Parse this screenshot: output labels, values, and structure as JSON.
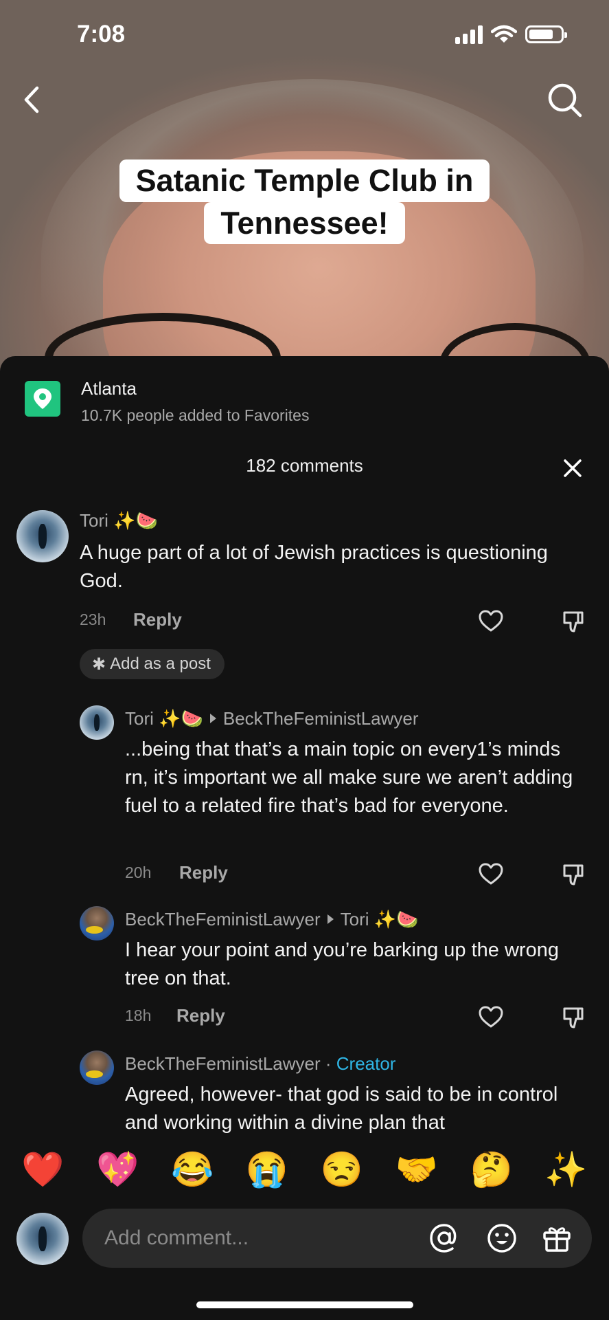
{
  "status": {
    "time": "7:08"
  },
  "video": {
    "caption_line1": "Satanic Temple Club in",
    "caption_line2": "Tennessee!"
  },
  "place": {
    "name": "Atlanta",
    "favorites": "10.7K people added to Favorites"
  },
  "comments_header": {
    "count_label": "182 comments"
  },
  "comments": [
    {
      "user": "Tori ✨🍉",
      "text": "A huge part of a lot of Jewish practices is questioning God.",
      "time": "23h",
      "reply_label": "Reply"
    },
    {
      "user": "Tori ✨🍉",
      "reply_to": "BeckTheFeministLawyer",
      "text": "...being that that’s a main topic on every1’s minds rn, it’s important we all make sure we aren’t adding fuel to a related fire that’s bad for everyone.",
      "time": "20h",
      "reply_label": "Reply"
    },
    {
      "user": "BeckTheFeministLawyer",
      "reply_to": "Tori ✨🍉",
      "text": "I hear your point and you’re barking up the wrong tree on that.",
      "time": "18h",
      "reply_label": "Reply"
    },
    {
      "user": "BeckTheFeministLawyer",
      "separator": " · ",
      "badge": "Creator",
      "text": "Agreed, however- that god is said to be in control and working within a divine plan that"
    }
  ],
  "add_post": {
    "label": "Add as a post"
  },
  "emoji_bar": [
    "❤️",
    "💖",
    "😂",
    "😭",
    "😒",
    "🤝",
    "🤔",
    "✨"
  ],
  "composer": {
    "placeholder": "Add comment..."
  }
}
